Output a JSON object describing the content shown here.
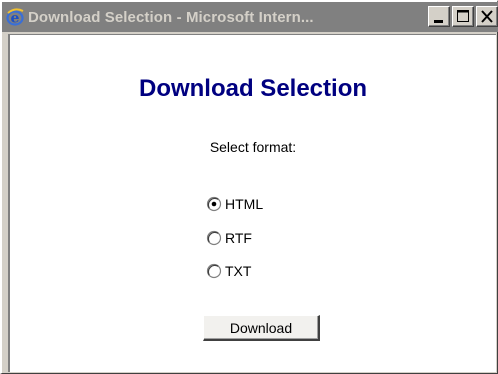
{
  "window": {
    "title": "Download Selection - Microsoft Intern...",
    "icon": "internet-explorer-icon",
    "controls": [
      "minimize-icon",
      "maximize-icon",
      "close-icon"
    ]
  },
  "page": {
    "heading": "Download Selection",
    "prompt": "Select format:",
    "formats": [
      {
        "label": "HTML",
        "selected": true
      },
      {
        "label": "RTF",
        "selected": false
      },
      {
        "label": "TXT",
        "selected": false
      }
    ],
    "download_label": "Download"
  },
  "colors": {
    "heading": "#000080",
    "titlebar_inactive": "#808080",
    "title_text": "#d4d0c8"
  }
}
